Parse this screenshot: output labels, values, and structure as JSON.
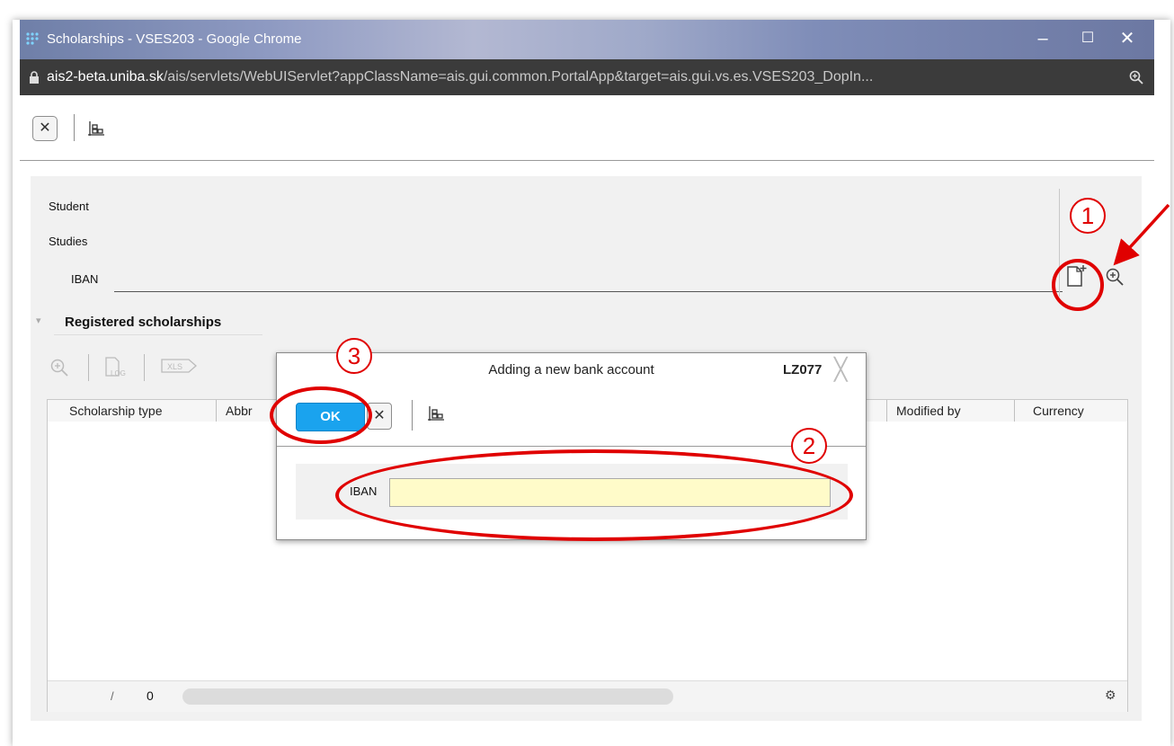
{
  "window": {
    "title": "Scholarships - VSES203 - Google Chrome",
    "url_host": "ais2-beta.uniba.sk",
    "url_path": "/ais/servlets/WebUIServlet?appClassName=ais.gui.common.PortalApp&target=ais.gui.vs.es.VSES203_DopIn...",
    "minimize": "–",
    "maximize": "☐",
    "close": "✕"
  },
  "toolbar": {
    "close_glyph": "✕"
  },
  "form": {
    "student_label": "Student",
    "studies_label": "Studies",
    "iban_label": "IBAN"
  },
  "section": {
    "title": "Registered scholarships",
    "collapse_glyph": "▾"
  },
  "grid": {
    "columns": [
      "Scholarship type",
      "Abbr",
      "Modified by",
      "Currency"
    ],
    "footer_slash": "/",
    "footer_count": "0",
    "settings_glyph": "⚙"
  },
  "dialog": {
    "title": "Adding a new bank account",
    "code": "LZ077",
    "close_glyph": "╳",
    "ok_label": "OK",
    "cancel_glyph": "✕",
    "iban_label": "IBAN",
    "iban_value": ""
  },
  "annotations": {
    "step1": "1",
    "step2": "2",
    "step3": "3",
    "color": "#e00000"
  },
  "colors": {
    "ok_button": "#1aa3ee",
    "input_highlight": "#fffbc9",
    "address_bar": "#3b3b3b"
  }
}
